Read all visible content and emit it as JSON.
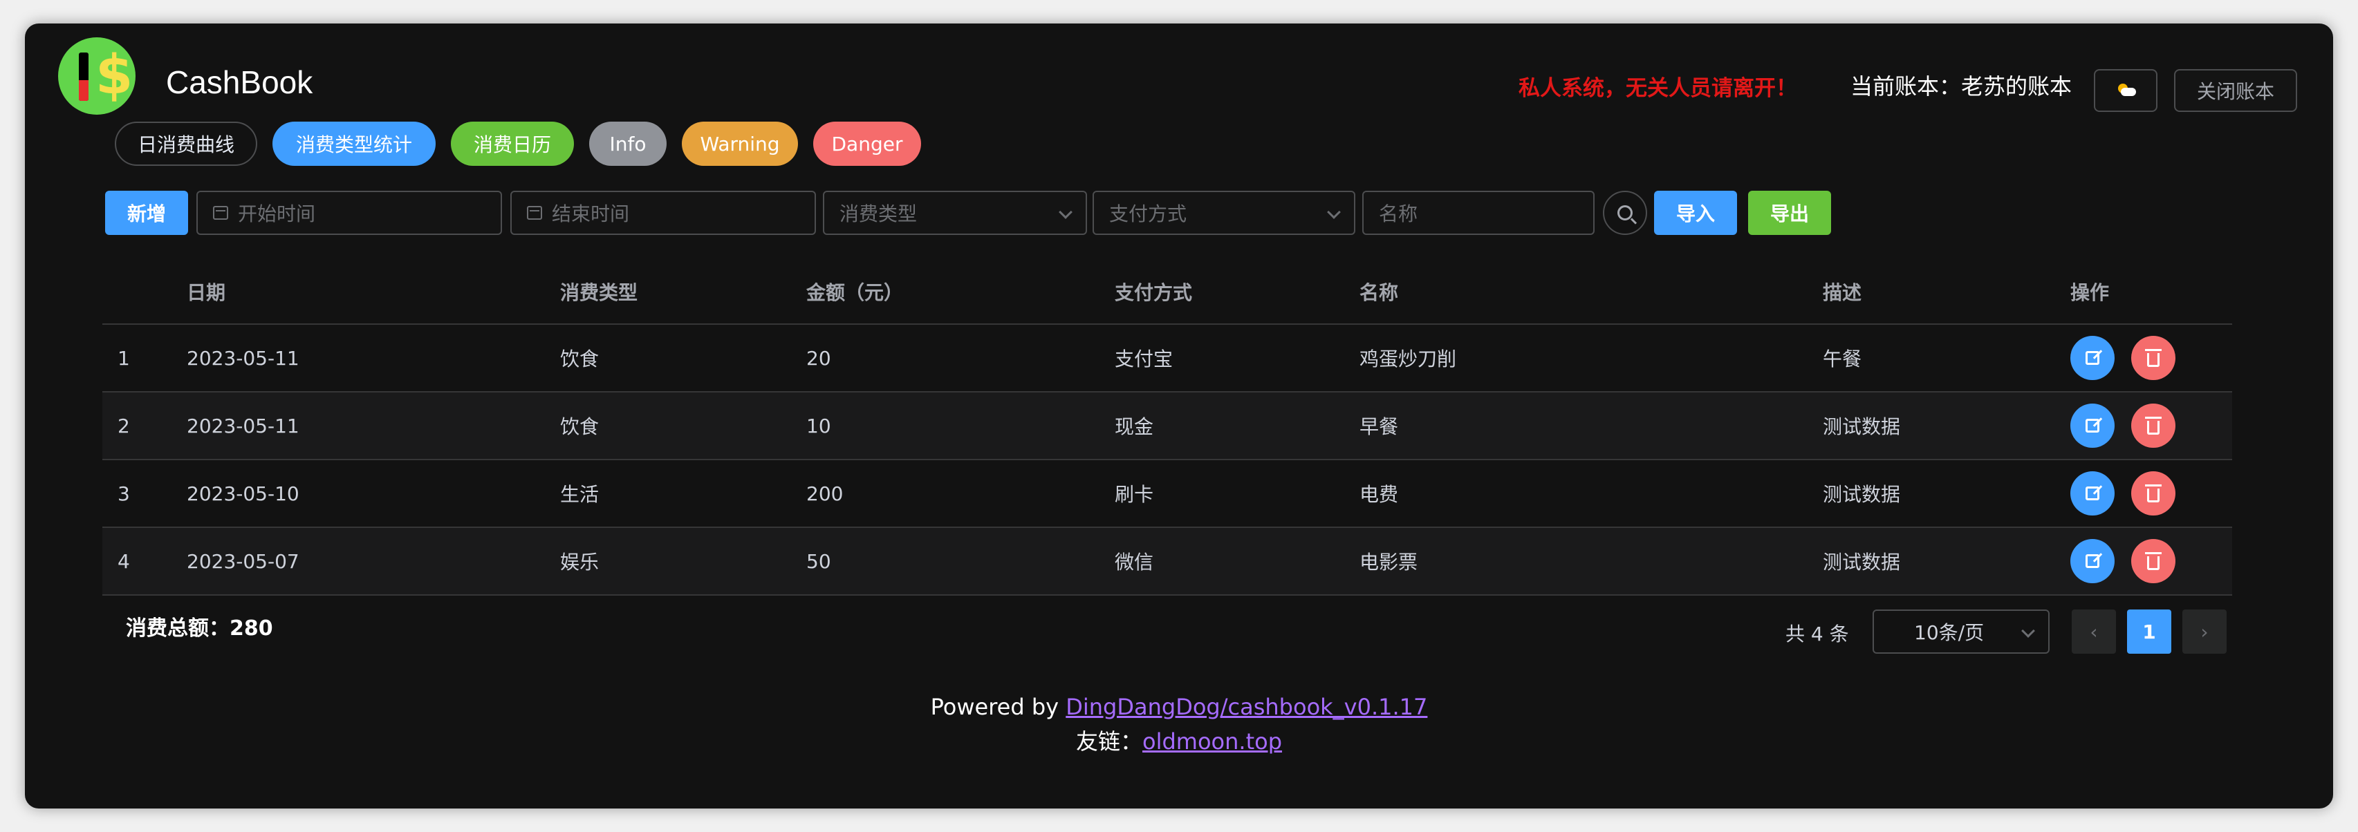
{
  "header": {
    "app_title": "CashBook",
    "warning": "私人系统，无关人员请离开！",
    "current_account": "当前账本：老苏的账本",
    "close_account": "关闭账本"
  },
  "tabs": [
    {
      "label": "日消费曲线"
    },
    {
      "label": "消费类型统计"
    },
    {
      "label": "消费日历"
    },
    {
      "label": "Info"
    },
    {
      "label": "Warning"
    },
    {
      "label": "Danger"
    }
  ],
  "toolbar": {
    "add_label": "新增",
    "start_placeholder": "开始时间",
    "end_placeholder": "结束时间",
    "type_placeholder": "消费类型",
    "pay_placeholder": "支付方式",
    "name_placeholder": "名称",
    "import_label": "导入",
    "export_label": "导出"
  },
  "table": {
    "headers": [
      "",
      "日期",
      "消费类型",
      "金额（元）",
      "支付方式",
      "名称",
      "描述",
      "操作"
    ],
    "rows": [
      [
        "1",
        "2023-05-11",
        "饮食",
        "20",
        "支付宝",
        "鸡蛋炒刀削",
        "午餐"
      ],
      [
        "2",
        "2023-05-11",
        "饮食",
        "10",
        "现金",
        "早餐",
        "测试数据"
      ],
      [
        "3",
        "2023-05-10",
        "生活",
        "200",
        "刷卡",
        "电费",
        "测试数据"
      ],
      [
        "4",
        "2023-05-07",
        "娱乐",
        "50",
        "微信",
        "电影票",
        "测试数据"
      ]
    ]
  },
  "summary": {
    "total": "消费总额：280"
  },
  "pagination": {
    "total_text": "共 4 条",
    "page_size": "10条/页",
    "current_page": "1"
  },
  "footer": {
    "powered_prefix": "Powered by ",
    "powered_link": "DingDangDog/cashbook_v0.1.17",
    "friend_prefix": "友链：",
    "friend_link": "oldmoon.top"
  },
  "colors": {
    "primary": "#409eff",
    "success": "#67c23a",
    "info": "#909399",
    "warning": "#e6a23c",
    "danger": "#f56c6c",
    "alert_text": "#e21818"
  }
}
